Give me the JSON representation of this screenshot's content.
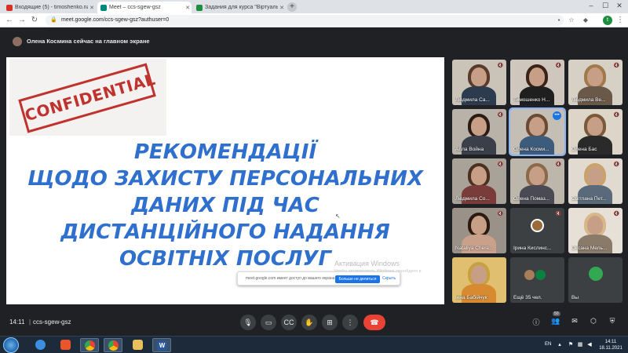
{
  "browser": {
    "tabs": [
      {
        "title": "Входящие (5) - timoshenko.natal",
        "favicon_color": "#d93025",
        "active": false
      },
      {
        "title": "Meet – ccs-sgew-gsz",
        "favicon_color": "#00897b",
        "active": true
      },
      {
        "title": "Задания для курса \"Віртуальна",
        "favicon_color": "#1e8e3e",
        "active": false
      }
    ],
    "new_tab": "+",
    "url": "meet.google.com/ccs-sgew-gsz?authuser=0",
    "profile_initial": "t"
  },
  "meet": {
    "presenting_text": "Олена Космина сейчас на главном экране",
    "slide": {
      "stamp_text": "CONFIDENTIAL",
      "title_lines": [
        "РЕКОМЕНДАЦІЇ",
        "ЩОДО ЗАХИСТУ ПЕРСОНАЛЬНИХ",
        "ДАНИХ ПІД ЧАС",
        "ДИСТАНЦІЙНОГО НАДАННЯ",
        "ОСВІТНІХ ПОСЛУГ"
      ],
      "watermark_title": "Активация Windows",
      "watermark_sub": "Чтобы активировать Windows, перейдите в"
    },
    "share_notice": {
      "text": "meet.google.com имеет доступ до вашего екрана.",
      "stop_button": "Больше не делиться",
      "hide_button": "Скрыть"
    },
    "participants": [
      {
        "name": "Людмила Са...",
        "muted": true,
        "hair": "#5a3a2a",
        "shirt": "#2d3b4f",
        "bg": "#c9c3b8"
      },
      {
        "name": "Тимошенко Н...",
        "muted": true,
        "hair": "#3b2417",
        "shirt": "#1f1f1f",
        "bg": "#cfc6bd"
      },
      {
        "name": "Людмила Ве...",
        "muted": true,
        "hair": "#a07a4a",
        "shirt": "#6a5848",
        "bg": "#d6d0c5"
      },
      {
        "name": "Алла Война",
        "muted": true,
        "hair": "#2a1c14",
        "shirt": "#3a3f4a",
        "bg": "#b8b2a8"
      },
      {
        "name": "Олена Косми...",
        "muted": false,
        "speaking": true,
        "hair": "#6b4a34",
        "shirt": "#3d5b7a",
        "bg": "#c4beb4"
      },
      {
        "name": "Олена Бас",
        "muted": true,
        "hair": "#7a5a3a",
        "shirt": "#2a2a2a",
        "bg": "#ddd6c8"
      },
      {
        "name": "Людмила Со...",
        "muted": true,
        "hair": "#4a3020",
        "shirt": "#7a3b3b",
        "bg": "#a8a298"
      },
      {
        "name": "Олена Помаз...",
        "muted": true,
        "hair": "#8a6a4a",
        "shirt": "#4a4a55",
        "bg": "#bdb6aa"
      },
      {
        "name": "Світлана Пет...",
        "muted": true,
        "hair": "#c9a36a",
        "shirt": "#5a6a7a",
        "bg": "#e0dad0"
      },
      {
        "name": "Nataliya Chere...",
        "muted": true,
        "hair": "#2a1a10",
        "shirt": "#c9a08a",
        "bg": "#9a9288"
      },
      {
        "name": "Ірина Кислинс...",
        "muted": true,
        "hair": "#9a6a3a",
        "shirt": "#3a3a3a",
        "bg": "#3c4043",
        "avatar": true
      },
      {
        "name": "Оксана Мель...",
        "muted": true,
        "hair": "#d8b88a",
        "shirt": "#8a7a6a",
        "bg": "#e6e0d6"
      },
      {
        "name": "Інна Бабійчук",
        "muted": false,
        "hair": "#c8a040",
        "shirt": "#d88a30",
        "bg": "#e0c070"
      },
      {
        "name": "Ещё 35 чел.",
        "muted": false,
        "group": true,
        "initial": "A",
        "initial_color": "#0b8043"
      },
      {
        "name": "Вы",
        "muted": false,
        "self": true,
        "initial": "T",
        "initial_color": "#33a852"
      }
    ]
  },
  "controls": {
    "time": "14:11",
    "separator": "|",
    "meeting_code": "ccs-sgew-gsz",
    "participants_badge": "50"
  },
  "taskbar": {
    "lang": "EN",
    "time": "14:11",
    "date": "18.11.2021"
  }
}
